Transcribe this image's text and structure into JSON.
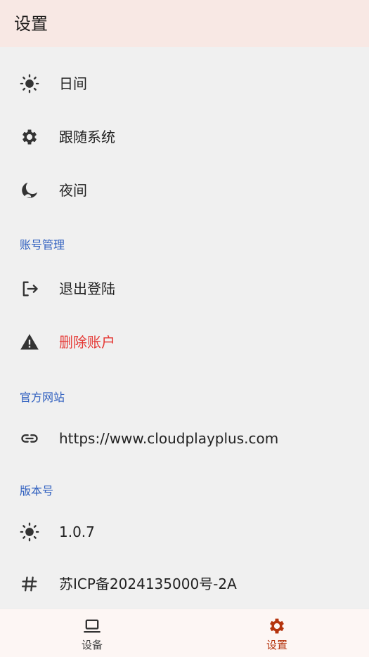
{
  "appbar": {
    "title": "设置"
  },
  "theme": {
    "items": [
      {
        "label": "日间",
        "icon": "sun-icon"
      },
      {
        "label": "跟随系统",
        "icon": "gear-icon"
      },
      {
        "label": "夜间",
        "icon": "moon-icon"
      }
    ]
  },
  "account": {
    "header": "账号管理",
    "logout_label": "退出登陆",
    "delete_label": "删除账户"
  },
  "website": {
    "header": "官方网站",
    "url": "https://www.cloudplayplus.com"
  },
  "version": {
    "header": "版本号",
    "number": "1.0.7",
    "icp": "苏ICP备2024135000号-2A"
  },
  "bottom_nav": {
    "items": [
      {
        "label": "设备",
        "icon": "laptop-icon",
        "active": false
      },
      {
        "label": "设置",
        "icon": "gear-icon",
        "active": true
      }
    ]
  },
  "colors": {
    "accent": "#b5340e",
    "section_header": "#2f5fbf",
    "danger": "#e53935",
    "appbar_bg": "#f8e8e4"
  }
}
